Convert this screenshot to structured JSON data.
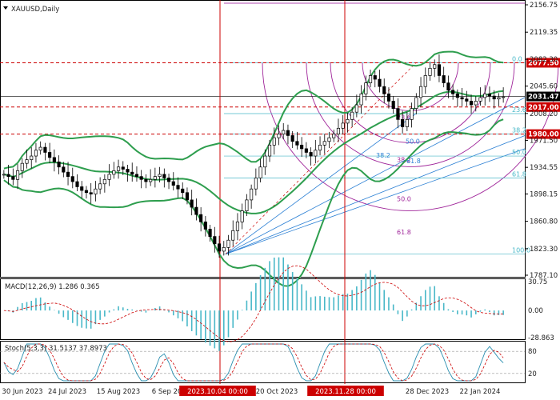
{
  "chart_data": {
    "type": "candlestick",
    "symbol": "XAUUSD,Daily",
    "price_axis_ticks": [
      "2156.75",
      "2119.35",
      "2082.30",
      "2045.60",
      "2008.20",
      "1971.50",
      "1934.55",
      "1898.15",
      "1860.80",
      "1823.30",
      "1787.10"
    ],
    "price_range": [
      1787.1,
      2156.75
    ],
    "x_labels": [
      "30 Jun 2023",
      "24 Jul 2023",
      "15 Aug 2023",
      "6 Sep 2023",
      "2023.10.04 00:00",
      "20 Oct 2023",
      "2023.11.28 00:00",
      "28 Dec 2023",
      "22 Jan 2024"
    ],
    "vertical_markers": [
      "2023.10.04 00:00",
      "2023.11.28 00:00"
    ],
    "levels": [
      {
        "value": 2077.5,
        "label": "2077.50",
        "color": "#cc0000"
      },
      {
        "value": 2031.47,
        "label": "2031.47",
        "color": "#000000"
      },
      {
        "value": 2017.0,
        "label": "2017.00",
        "color": "#cc0000"
      },
      {
        "value": 1980.0,
        "label": "1980.00",
        "color": "#cc0000"
      }
    ],
    "fib_retracement_labels": [
      "0.0",
      "23.6",
      "38.2",
      "50.0",
      "61.8",
      "100.0"
    ],
    "fib_fan_labels": [
      "38.2",
      "50.0",
      "61.8"
    ],
    "fib_arc_labels": [
      "23.6",
      "38.2",
      "50.0",
      "61.8"
    ],
    "close_approx": [
      1925,
      1922,
      1918,
      1930,
      1940,
      1945,
      1950,
      1958,
      1962,
      1955,
      1948,
      1942,
      1935,
      1928,
      1922,
      1915,
      1908,
      1903,
      1900,
      1898,
      1905,
      1912,
      1918,
      1925,
      1930,
      1935,
      1932,
      1928,
      1925,
      1922,
      1918,
      1915,
      1918,
      1922,
      1925,
      1920,
      1915,
      1910,
      1905,
      1900,
      1890,
      1880,
      1870,
      1860,
      1850,
      1840,
      1830,
      1820,
      1825,
      1835,
      1848,
      1860,
      1875,
      1890,
      1905,
      1920,
      1935,
      1950,
      1965,
      1975,
      1980,
      1985,
      1978,
      1970,
      1965,
      1960,
      1955,
      1950,
      1958,
      1965,
      1970,
      1975,
      1980,
      1988,
      1995,
      2000,
      2010,
      2020,
      2035,
      2050,
      2060,
      2055,
      2045,
      2035,
      2025,
      2015,
      2000,
      1990,
      2000,
      2015,
      2030,
      2045,
      2060,
      2070,
      2075,
      2060,
      2050,
      2040,
      2035,
      2030,
      2028,
      2025,
      2020,
      2025,
      2030,
      2035,
      2032,
      2028,
      2030,
      2031
    ]
  },
  "macd": {
    "label": "MACD(12,26,9) 1.286 0.365",
    "ticks": [
      "30.75",
      "0.00",
      "-28.863"
    ]
  },
  "stoch": {
    "label": "Stoch(5,3,3) 31.5137 37.8973",
    "ticks": [
      "80",
      "20"
    ]
  }
}
